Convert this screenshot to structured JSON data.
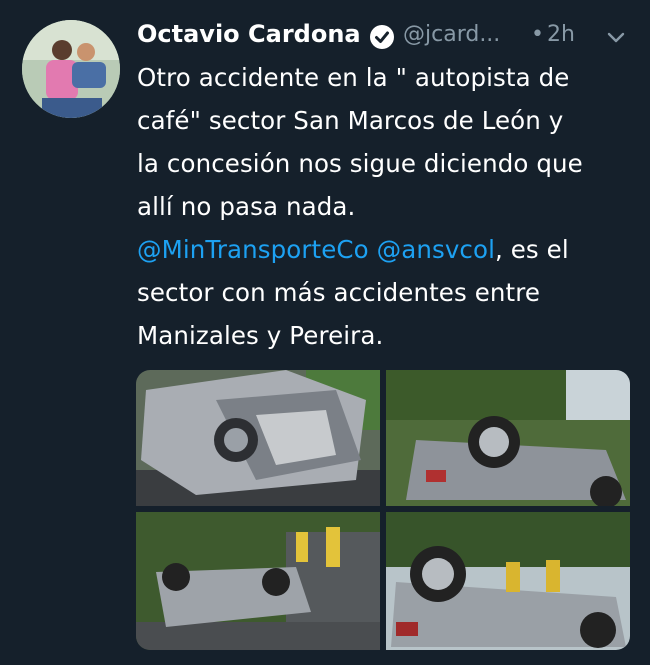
{
  "tweet": {
    "author_name": "Octavio Cardona",
    "handle": "@jcard...",
    "separator": "•",
    "time": "2h",
    "lines": [
      "Otro accidente en la \" autopista de",
      "café\" sector San Marcos de León y",
      "la concesión nos sigue diciendo que",
      "allí no pasa nada."
    ],
    "mention1": "@MinTransporteCo",
    "mention2": "@ansvcol",
    "mentions_tail": ", es el",
    "lines2": [
      "sector con más accidentes entre",
      "Manizales y Pereira."
    ]
  },
  "colors": {
    "background": "#15202b",
    "text": "#ffffff",
    "secondary": "#8899a6",
    "mention": "#1da1f2"
  },
  "icons": {
    "verified": "verified-badge-icon",
    "menu": "chevron-down-icon"
  }
}
